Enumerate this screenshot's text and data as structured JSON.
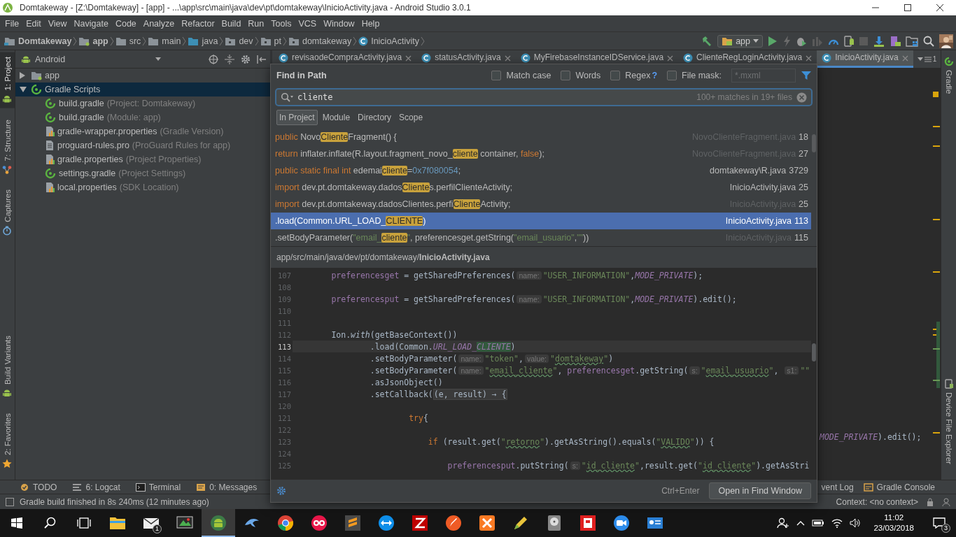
{
  "window": {
    "title": "Domtakeway - [Z:\\Domtakeway] - [app] - ...\\app\\src\\main\\java\\dev\\pt\\domtakeway\\InicioActivity.java - Android Studio 3.0.1"
  },
  "menu": [
    "File",
    "Edit",
    "View",
    "Navigate",
    "Code",
    "Analyze",
    "Refactor",
    "Build",
    "Run",
    "Tools",
    "VCS",
    "Window",
    "Help"
  ],
  "breadcrumbs": [
    {
      "kind": "project",
      "label": "Domtakeway"
    },
    {
      "kind": "module",
      "label": "app"
    },
    {
      "kind": "folder",
      "label": "src"
    },
    {
      "kind": "folder",
      "label": "main"
    },
    {
      "kind": "source",
      "label": "java"
    },
    {
      "kind": "package",
      "label": "dev"
    },
    {
      "kind": "package",
      "label": "pt"
    },
    {
      "kind": "package",
      "label": "domtakeway"
    },
    {
      "kind": "class",
      "label": "InicioActivity"
    }
  ],
  "toolbar": {
    "run_config": "app"
  },
  "left_tabs_top": [
    {
      "label": "1: Project",
      "kind": "android",
      "selected": true
    },
    {
      "label": "7: Structure",
      "kind": "structure",
      "selected": false
    },
    {
      "label": "Captures",
      "kind": "captures",
      "selected": false
    }
  ],
  "left_tabs_bottom": [
    {
      "label": "Build Variants",
      "kind": "android",
      "selected": false
    },
    {
      "label": "2: Favorites",
      "kind": "star",
      "selected": false
    }
  ],
  "project_panel": {
    "view": "Android",
    "tree": [
      {
        "label": "app",
        "kind": "module",
        "expanded": false,
        "selected": false
      },
      {
        "label": "Gradle Scripts",
        "kind": "gradle",
        "expanded": true,
        "selected": true,
        "children": [
          {
            "label": "build.gradle",
            "hint": "(Project: Domtakeway)",
            "kind": "gradle",
            "selected": false
          },
          {
            "label": "build.gradle",
            "hint": "(Module: app)",
            "kind": "gradle",
            "selected": false
          },
          {
            "label": "gradle-wrapper.properties",
            "hint": "(Gradle Version)",
            "kind": "properties",
            "selected": false
          },
          {
            "label": "proguard-rules.pro",
            "hint": "(ProGuard Rules for app)",
            "kind": "text",
            "selected": false
          },
          {
            "label": "gradle.properties",
            "hint": "(Project Properties)",
            "kind": "properties",
            "selected": false
          },
          {
            "label": "settings.gradle",
            "hint": "(Project Settings)",
            "kind": "gradle",
            "selected": false
          },
          {
            "label": "local.properties",
            "hint": "(SDK Location)",
            "kind": "properties",
            "selected": false
          }
        ]
      }
    ]
  },
  "editor": {
    "tabs": [
      {
        "label": "revisaodeCompraActivity.java",
        "selected": false
      },
      {
        "label": "statusActivity.java",
        "selected": false
      },
      {
        "label": "MyFirebaseInstanceIDService.java",
        "selected": false
      },
      {
        "label": "ClienteRegLoginActivity.java",
        "selected": false
      },
      {
        "label": "InicioActivity.java",
        "selected": true
      }
    ],
    "tab_overflow": "1",
    "visible_code": [
      {
        "kind": "constant",
        "text": "MODE_PRIVATE"
      },
      {
        "kind": "plain",
        "text": ").edit();"
      }
    ]
  },
  "right_tabs": [
    {
      "label": "Gradle",
      "kind": "gradle"
    },
    {
      "label": "Device File Explorer",
      "kind": "device"
    }
  ],
  "find_dialog": {
    "title": "Find in Path",
    "options": [
      {
        "label": "Match case",
        "checked": false
      },
      {
        "label": "Words",
        "checked": false
      },
      {
        "label": "Regex",
        "help": "?",
        "checked": false
      },
      {
        "label": "File mask:",
        "checked": false
      }
    ],
    "file_mask": {
      "placeholder": "*.mxml",
      "disabled": true
    },
    "search": {
      "value": "cliente",
      "summary": "100+ matches in 19+ files"
    },
    "scopes": [
      {
        "label": "In Project",
        "selected": true
      },
      {
        "label": "Module",
        "selected": false
      },
      {
        "label": "Directory",
        "selected": false
      },
      {
        "label": "Scope",
        "selected": false
      }
    ],
    "results": [
      {
        "segments": [
          {
            "kind": "keyword",
            "text": "public"
          },
          {
            "kind": "plain",
            "text": " Novo"
          },
          {
            "kind": "match",
            "text": "Cliente"
          },
          {
            "kind": "plain",
            "text": "Fragment() {"
          }
        ],
        "file": "NovoClienteFragment.java",
        "line": "18",
        "dimmed": true,
        "selected": false
      },
      {
        "segments": [
          {
            "kind": "keyword",
            "text": "return"
          },
          {
            "kind": "plain",
            "text": " inflater.inflate(R.layout.fragment_novo_"
          },
          {
            "kind": "match",
            "text": "cliente"
          },
          {
            "kind": "plain",
            "text": " container, "
          },
          {
            "kind": "keyword",
            "text": "false"
          },
          {
            "kind": "plain",
            "text": ");"
          }
        ],
        "file": "NovoClienteFragment.java",
        "line": "27",
        "dimmed": true,
        "selected": false
      },
      {
        "segments": [
          {
            "kind": "keyword",
            "text": "public static final int"
          },
          {
            "kind": "plain",
            "text": " edemai"
          },
          {
            "kind": "match",
            "text": "cliente"
          },
          {
            "kind": "plain",
            "text": "="
          },
          {
            "kind": "number",
            "text": "0x7f080054"
          },
          {
            "kind": "plain",
            "text": ";"
          }
        ],
        "file": "domtakeway\\R.java",
        "line": "3729",
        "dimmed": false,
        "selected": false
      },
      {
        "segments": [
          {
            "kind": "keyword",
            "text": "import"
          },
          {
            "kind": "plain",
            "text": " dev.pt.domtakeway.dados"
          },
          {
            "kind": "match",
            "text": "Cliente"
          },
          {
            "kind": "plain",
            "text": "s.perfilClienteActivity;"
          }
        ],
        "file": "InicioActivity.java",
        "line": "25",
        "dimmed": false,
        "selected": false
      },
      {
        "segments": [
          {
            "kind": "keyword",
            "text": "import"
          },
          {
            "kind": "plain",
            "text": " dev.pt.domtakeway.dadosClientes.perfi"
          },
          {
            "kind": "match",
            "text": "Cliente"
          },
          {
            "kind": "plain",
            "text": "Activity;"
          }
        ],
        "file": "InicioActivity.java",
        "line": "25",
        "dimmed": true,
        "selected": false
      },
      {
        "segments": [
          {
            "kind": "plain",
            "text": ".load(Common.URL_LOAD_"
          },
          {
            "kind": "match",
            "text": "CLIENTE"
          },
          {
            "kind": "plain",
            "text": ")"
          }
        ],
        "file": "InicioActivity.java",
        "line": "113",
        "dimmed": false,
        "selected": true
      },
      {
        "segments": [
          {
            "kind": "plain",
            "text": ".setBodyParameter("
          },
          {
            "kind": "string",
            "text": "\"email_"
          },
          {
            "kind": "match",
            "text": "cliente"
          },
          {
            "kind": "string",
            "text": "\""
          },
          {
            "kind": "plain",
            "text": ", preferencesget.getString("
          },
          {
            "kind": "string",
            "text": "\"email_usuario\""
          },
          {
            "kind": "plain",
            "text": ","
          },
          {
            "kind": "string",
            "text": "\"\""
          },
          {
            "kind": "plain",
            "text": "))"
          }
        ],
        "file": "InicioActivity.java",
        "line": "115",
        "dimmed": true,
        "selected": false
      }
    ],
    "preview": {
      "path": "app/src/main/java/dev/pt/domtakeway/**InicioActivity.java**",
      "lines": [
        {
          "number": "107",
          "current": false,
          "tokens": [
            {
              "kind": "field",
              "text": "preferencesget"
            },
            {
              "kind": "plain",
              "text": " = getSharedPreferences("
            },
            {
              "kind": "hint",
              "text": "name:"
            },
            {
              "kind": "string",
              "text": "\"USER_INFORMATION\""
            },
            {
              "kind": "plain",
              "text": ","
            },
            {
              "kind": "constant",
              "text": "MODE_PRIVATE"
            },
            {
              "kind": "plain",
              "text": ");"
            }
          ]
        },
        {
          "number": "108",
          "current": false
        },
        {
          "number": "109",
          "current": false,
          "tokens": [
            {
              "kind": "field",
              "text": "preferencesput"
            },
            {
              "kind": "plain",
              "text": " = getSharedPreferences("
            },
            {
              "kind": "hint",
              "text": "name:"
            },
            {
              "kind": "string",
              "text": "\"USER_INFORMATION\""
            },
            {
              "kind": "plain",
              "text": ","
            },
            {
              "kind": "constant",
              "text": "MODE_PRIVATE"
            },
            {
              "kind": "plain",
              "text": ").edit();"
            }
          ]
        },
        {
          "number": "110",
          "current": false
        },
        {
          "number": "111",
          "current": false
        },
        {
          "number": "112",
          "current": false,
          "tokens": [
            {
              "kind": "plain",
              "text": "Ion."
            },
            {
              "kind": "static",
              "text": "with"
            },
            {
              "kind": "plain",
              "text": "(getBaseContext())"
            }
          ],
          "children": [
            {
              "number": "113",
              "current": true,
              "tokens": [
                {
                  "kind": "plain",
                  "text": ".load(Common."
                },
                {
                  "kind": "constant",
                  "text": "URL_LOAD_"
                },
                {
                  "kind": "match",
                  "text": "CLIENTE"
                },
                {
                  "kind": "plain",
                  "text": ")"
                }
              ]
            },
            {
              "number": "114",
              "current": false,
              "tokens": [
                {
                  "kind": "plain",
                  "text": ".setBodyParameter("
                },
                {
                  "kind": "hint",
                  "text": "name:"
                },
                {
                  "kind": "string",
                  "text": "\"token\""
                },
                {
                  "kind": "plain",
                  "text": ","
                },
                {
                  "kind": "hint",
                  "text": "value:"
                },
                {
                  "kind": "string",
                  "text": "\""
                },
                {
                  "kind": "typo",
                  "text": "domtakeway"
                },
                {
                  "kind": "string",
                  "text": "\""
                },
                {
                  "kind": "plain",
                  "text": ")"
                }
              ]
            },
            {
              "number": "115",
              "current": false,
              "tokens": [
                {
                  "kind": "plain",
                  "text": ".setBodyParameter("
                },
                {
                  "kind": "hint",
                  "text": "name:"
                },
                {
                  "kind": "string",
                  "text": "\""
                },
                {
                  "kind": "typo",
                  "text": "email_cliente"
                },
                {
                  "kind": "string",
                  "text": "\""
                },
                {
                  "kind": "plain",
                  "text": ", "
                },
                {
                  "kind": "field",
                  "text": "preferencesget"
                },
                {
                  "kind": "plain",
                  "text": ".getString("
                },
                {
                  "kind": "hint",
                  "text": "s:"
                },
                {
                  "kind": "string",
                  "text": "\""
                },
                {
                  "kind": "typo",
                  "text": "email_usuario"
                },
                {
                  "kind": "string",
                  "text": "\""
                },
                {
                  "kind": "plain",
                  "text": ", "
                },
                {
                  "kind": "hint",
                  "text": "s1:"
                },
                {
                  "kind": "string",
                  "text": "\"\""
                }
              ]
            },
            {
              "number": "116",
              "current": false,
              "tokens": [
                {
                  "kind": "plain",
                  "text": ".asJsonObject()"
                }
              ]
            },
            {
              "number": "117",
              "current": false,
              "tokens": [
                {
                  "kind": "plain",
                  "text": ".setCallback("
                },
                {
                  "kind": "fold",
                  "text": "(e, result) → {"
                }
              ],
              "children": [
                {
                  "number": "120",
                  "current": false
                },
                {
                  "number": "121",
                  "current": false,
                  "tokens": [
                    {
                      "kind": "keyword",
                      "text": "try"
                    },
                    {
                      "kind": "plain",
                      "text": "{"
                    }
                  ],
                  "children": [
                    {
                      "number": "122",
                      "current": false
                    },
                    {
                      "number": "123",
                      "current": false,
                      "tokens": [
                        {
                          "kind": "keyword",
                          "text": "if"
                        },
                        {
                          "kind": "plain",
                          "text": " (result.get("
                        },
                        {
                          "kind": "string",
                          "text": "\""
                        },
                        {
                          "kind": "typo",
                          "text": "retorno"
                        },
                        {
                          "kind": "string",
                          "text": "\""
                        },
                        {
                          "kind": "plain",
                          "text": ").getAsString().equals("
                        },
                        {
                          "kind": "string",
                          "text": "\""
                        },
                        {
                          "kind": "typo",
                          "text": "VALIDO"
                        },
                        {
                          "kind": "string",
                          "text": "\""
                        },
                        {
                          "kind": "plain",
                          "text": ")) {"
                        }
                      ],
                      "children": [
                        {
                          "number": "124",
                          "current": false
                        },
                        {
                          "number": "125",
                          "current": false,
                          "tokens": [
                            {
                              "kind": "field",
                              "text": "preferencesput"
                            },
                            {
                              "kind": "plain",
                              "text": ".putString("
                            },
                            {
                              "kind": "hint",
                              "text": "s:"
                            },
                            {
                              "kind": "string",
                              "text": "\""
                            },
                            {
                              "kind": "typo",
                              "text": "id_cliente"
                            },
                            {
                              "kind": "string",
                              "text": "\""
                            },
                            {
                              "kind": "plain",
                              "text": ",result.get("
                            },
                            {
                              "kind": "string",
                              "text": "\""
                            },
                            {
                              "kind": "typo",
                              "text": "id_cliente"
                            },
                            {
                              "kind": "string",
                              "text": "\""
                            },
                            {
                              "kind": "plain",
                              "text": ").getAsStri"
                            }
                          ]
                        }
                      ]
                    }
                  ]
                }
              ]
            }
          ]
        }
      ]
    },
    "footer": {
      "shortcut": "Ctrl+Enter",
      "button": "Open in Find Window"
    }
  },
  "tool_bar": {
    "left": [
      {
        "label": "TODO",
        "kind": "todo"
      },
      {
        "label": "6: Logcat",
        "kind": "logcat"
      },
      {
        "label": "Terminal",
        "kind": "terminal"
      },
      {
        "label": "0: Messages",
        "kind": "messages"
      }
    ],
    "right": [
      {
        "label": "vent Log",
        "kind": "plain"
      },
      {
        "label": "Gradle Console",
        "kind": "console"
      }
    ]
  },
  "status_bar": {
    "message": "Gradle build finished in 8s 240ms (12 minutes ago)",
    "context": "Context: <no context>"
  },
  "taskbar": {
    "apps": [
      {
        "kind": "folder",
        "selected": false
      },
      {
        "kind": "mail",
        "badge": "1",
        "selected": false
      },
      {
        "kind": "paint",
        "selected": false
      },
      {
        "kind": "android",
        "selected": true
      },
      {
        "kind": "dolphin",
        "selected": false
      },
      {
        "kind": "chrome",
        "selected": false
      },
      {
        "kind": "dots",
        "selected": false
      },
      {
        "kind": "sublime",
        "selected": false
      },
      {
        "kind": "teamviewer",
        "selected": false
      },
      {
        "kind": "filezilla",
        "selected": false
      },
      {
        "kind": "rocket",
        "selected": false
      },
      {
        "kind": "xampp",
        "selected": false
      },
      {
        "kind": "pen",
        "selected": false
      },
      {
        "kind": "disk",
        "selected": false
      },
      {
        "kind": "reader",
        "selected": false
      },
      {
        "kind": "video",
        "selected": false
      },
      {
        "kind": "card",
        "selected": false
      }
    ],
    "time": "11:02",
    "date": "23/03/2018",
    "notifications": "3"
  }
}
